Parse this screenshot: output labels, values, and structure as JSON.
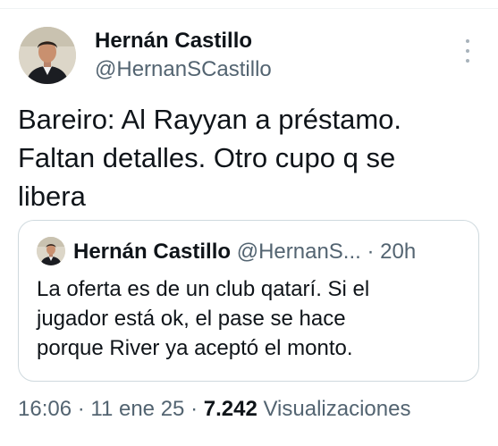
{
  "tweet": {
    "author_name": "Hernán Castillo",
    "author_handle": "@HernanSCastillo",
    "text": "Bareiro: Al Rayyan a préstamo.\nFaltan detalles. Otro cupo q se\nlibera",
    "more_icon": "more-vertical-icon"
  },
  "quote": {
    "author_name": "Hernán Castillo",
    "author_handle": "@HernanS...",
    "separator": "·",
    "time": "20h",
    "text": "La oferta es de un club qatarí. Si el\njugador está ok, el pase se hace\nporque River ya aceptó el monto."
  },
  "meta": {
    "time": "16:06",
    "sep1": "·",
    "date": "11 ene 25",
    "sep2": "·",
    "views_count": "7.242",
    "views_label": "Visualizaciones"
  },
  "colors": {
    "text": "#0f1419",
    "secondary": "#536471",
    "border": "#cfd9de"
  }
}
